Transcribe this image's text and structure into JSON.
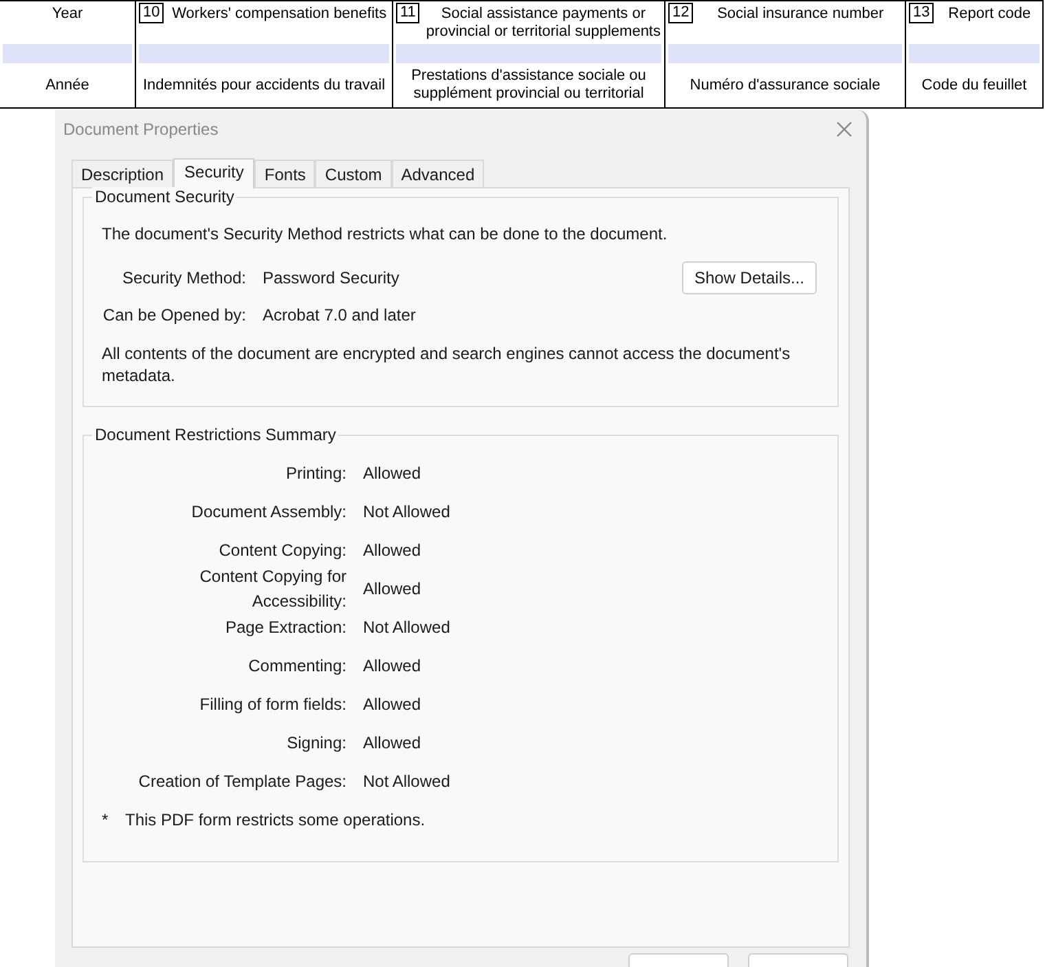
{
  "form_header": {
    "columns": [
      {
        "label": "Year",
        "french": "Année"
      },
      {
        "number": "10",
        "label": "Workers' compensation benefits",
        "french": "Indemnités pour accidents du travail"
      },
      {
        "number": "11",
        "label": "Social assistance payments or provincial or territorial supplements",
        "french": "Prestations d'assistance sociale ou supplément provincial ou territorial"
      },
      {
        "number": "12",
        "label": "Social insurance number",
        "french": "Numéro d'assurance sociale"
      },
      {
        "number": "13",
        "label": "Report code",
        "french": "Code du feuillet"
      }
    ]
  },
  "dialog": {
    "title": "Document Properties",
    "tabs": [
      {
        "label": "Description",
        "selected": false
      },
      {
        "label": "Security",
        "selected": true
      },
      {
        "label": "Fonts",
        "selected": false
      },
      {
        "label": "Custom",
        "selected": false
      },
      {
        "label": "Advanced",
        "selected": false
      }
    ],
    "security": {
      "title": "Document Security",
      "description": "The document's Security Method restricts what can be done to the document.",
      "fields": [
        {
          "label": "Security Method:",
          "value": "Password Security"
        },
        {
          "label": "Can be Opened by:",
          "value": "Acrobat 7.0 and later"
        }
      ],
      "details_button": "Show Details...",
      "note": "All contents of the document are encrypted and search engines cannot access the document's metadata."
    },
    "restrictions": {
      "title": "Document Restrictions Summary",
      "rows": [
        {
          "label": "Printing:",
          "value": "Allowed"
        },
        {
          "label": "Document Assembly:",
          "value": "Not Allowed"
        },
        {
          "label": "Content Copying:",
          "value": "Allowed"
        },
        {
          "label": "Content Copying for Accessibility:",
          "value": "Allowed"
        },
        {
          "label": "Page Extraction:",
          "value": "Not Allowed"
        },
        {
          "label": "Commenting:",
          "value": "Allowed"
        },
        {
          "label": "Filling of form fields:",
          "value": "Allowed"
        },
        {
          "label": "Signing:",
          "value": "Allowed"
        },
        {
          "label": "Creation of Template Pages:",
          "value": "Not Allowed"
        }
      ],
      "footnote_mark": "*",
      "footnote": "This PDF form restricts some operations."
    }
  }
}
